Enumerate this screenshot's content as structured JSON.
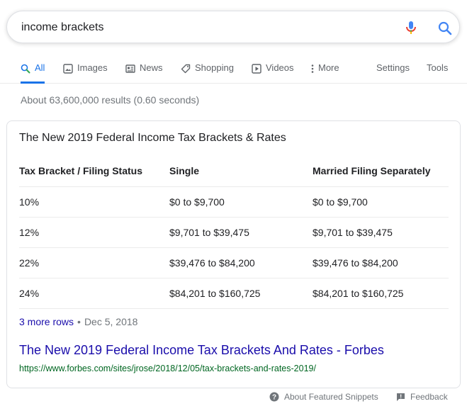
{
  "search": {
    "query": "income brackets"
  },
  "tabs": [
    {
      "label": "All",
      "icon": "search-icon",
      "active": true
    },
    {
      "label": "Images",
      "icon": "image-icon"
    },
    {
      "label": "News",
      "icon": "news-icon"
    },
    {
      "label": "Shopping",
      "icon": "tag-icon"
    },
    {
      "label": "Videos",
      "icon": "play-icon"
    },
    {
      "label": "More",
      "icon": "more-vertical-icon"
    },
    {
      "label": "Settings"
    },
    {
      "label": "Tools"
    }
  ],
  "results_info": "About 63,600,000 results (0.60 seconds)",
  "snippet": {
    "title": "The New 2019 Federal Income Tax Brackets & Rates",
    "table": {
      "headers": [
        "Tax Bracket / Filing Status",
        "Single",
        "Married Filing Separately"
      ],
      "rows": [
        [
          "10%",
          "$0 to $9,700",
          "$0 to $9,700"
        ],
        [
          "12%",
          "$9,701 to $39,475",
          "$9,701 to $39,475"
        ],
        [
          "22%",
          "$39,476 to $84,200",
          "$39,476 to $84,200"
        ],
        [
          "24%",
          "$84,201 to $160,725",
          "$84,201 to $160,725"
        ]
      ]
    },
    "more_rows": "3 more rows",
    "separator": "•",
    "date": "Dec 5, 2018",
    "result_title": "The New 2019 Federal Income Tax Brackets And Rates - Forbes",
    "result_url": "https://www.forbes.com/sites/jrose/2018/12/05/tax-brackets-and-rates-2019/"
  },
  "footer": {
    "about": "About Featured Snippets",
    "feedback": "Feedback"
  },
  "colors": {
    "accent": "#1a73e8",
    "link": "#1a0dab",
    "url_green": "#006621",
    "muted": "#70757a"
  }
}
